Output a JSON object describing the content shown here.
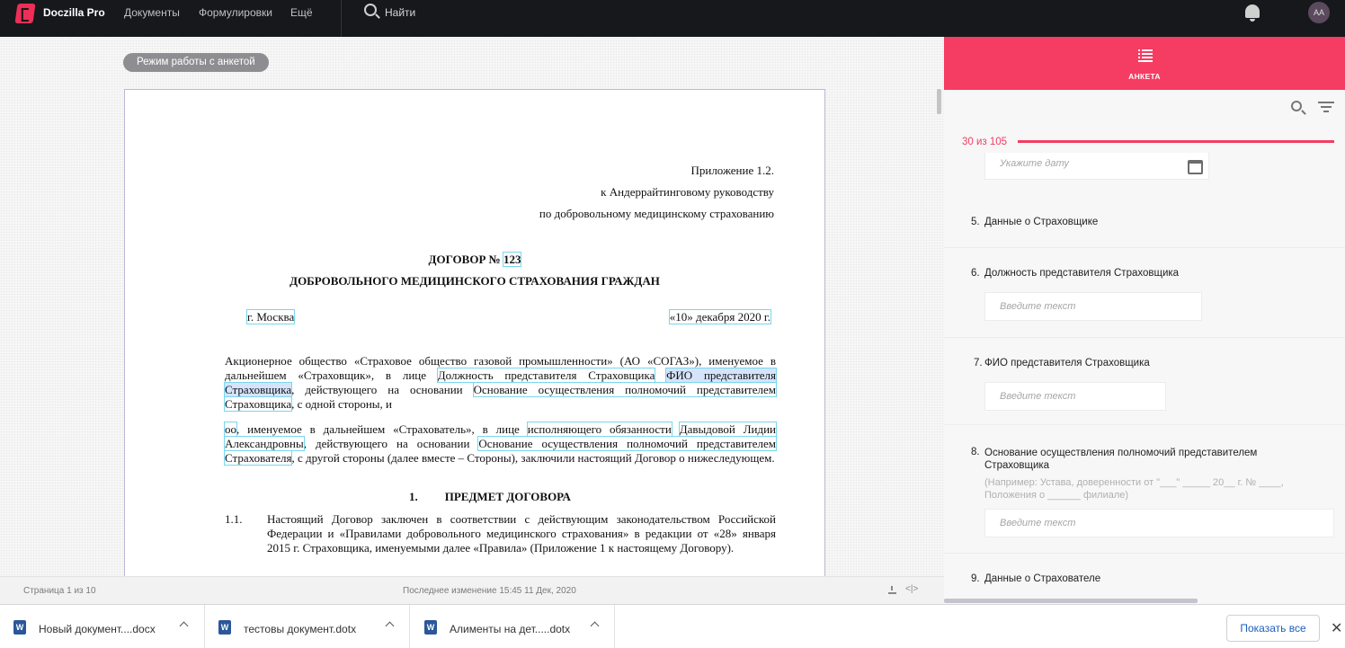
{
  "app": {
    "brand": "Doczilla Pro",
    "nav": [
      "Документы",
      "Формулировки",
      "Ещё"
    ],
    "search_label": "Найти",
    "avatar": "AA",
    "accent": "#f53c62"
  },
  "editor": {
    "mode_label": "Режим работы с анкетой",
    "header_lines": [
      "Приложение 1.2.",
      "к Андеррайтинговому руководству",
      "по добровольному медицинскому страхованию"
    ],
    "title_prefix": "ДОГОВОР № ",
    "title_number": "123",
    "subtitle": "ДОБРОВОЛЬНОГО МЕДИЦИНСКОГО СТРАХОВАНИЯ ГРАЖДАН",
    "city": "г. Москва",
    "date": "«10» декабря 2020 г.",
    "p1": {
      "t1": "Акционерное общество «Страховое общество газовой промышленности» (АО «СОГАЗ»), именуемое в дальнейшем «Страховщик», в лице ",
      "f1": "Должность представителя Страховщика",
      "t2": " ",
      "f2": "ФИО представителя Страховщика",
      "t3": ", действующего на основании ",
      "f3": "Основание осуществления полномочий представителем Страховщика",
      "t4": ", с одной стороны, и"
    },
    "p2": {
      "f1": "оо",
      "t1": ", именуемое в дальнейшем «Страхователь», в лице ",
      "f2": "исполняющего обязанности",
      "t2": " ",
      "f3": "Давыдовой Лидии Александровны",
      "t3": ", действующего на основании ",
      "f4": "Основание осуществления полномочий представителем Страхователя",
      "t4": ", с другой стороны (далее вместе – Стороны), заключили настоящий Договор о нижеследующем."
    },
    "section_num": "1.",
    "section_title": "ПРЕДМЕТ ДОГОВОРА",
    "clause_num": "1.1.",
    "clause_text": "Настоящий Договор заключен в соответствии с действующим законодательством Российской Федерации и «Правилами добровольного медицинского страхования» в редакции от «28» января 2015 г. Страховщика, именуемыми далее «Правила» (Приложение 1 к настоящему Договору).",
    "status_page": "Страница 1 из 10",
    "status_modified": "Последнее изменение 15:45 11 Дек, 2020",
    "status_code": "<|>"
  },
  "panel": {
    "tab_label": "АНКЕТА",
    "progress_text": "30 из 105",
    "progress": 1.0,
    "date_placeholder": "Укажите дату",
    "questions": [
      {
        "num": "5.",
        "label": "Данные о Страховщике"
      },
      {
        "num": "6.",
        "label": "Должность представителя Страховщика",
        "placeholder": "Введите текст"
      },
      {
        "num": "7.",
        "label": "ФИО представителя Страховщика",
        "placeholder": "Введите текст"
      },
      {
        "num": "8.",
        "label": "Основание осуществления полномочий представителем Страховщика",
        "hint": "(Например: Устава, доверенности от \"___\" _____ 20__ г. № ____, Положения о ______ филиале)",
        "placeholder": "Введите текст"
      },
      {
        "num": "9.",
        "label": "Данные о Страхователе"
      }
    ]
  },
  "downloads": {
    "items": [
      "Новый документ....docx",
      "тестовы документ.dotx",
      "Алименты на дет.....dotx"
    ],
    "word_icon": "W",
    "show_all": "Показать все",
    "close": "✕"
  }
}
